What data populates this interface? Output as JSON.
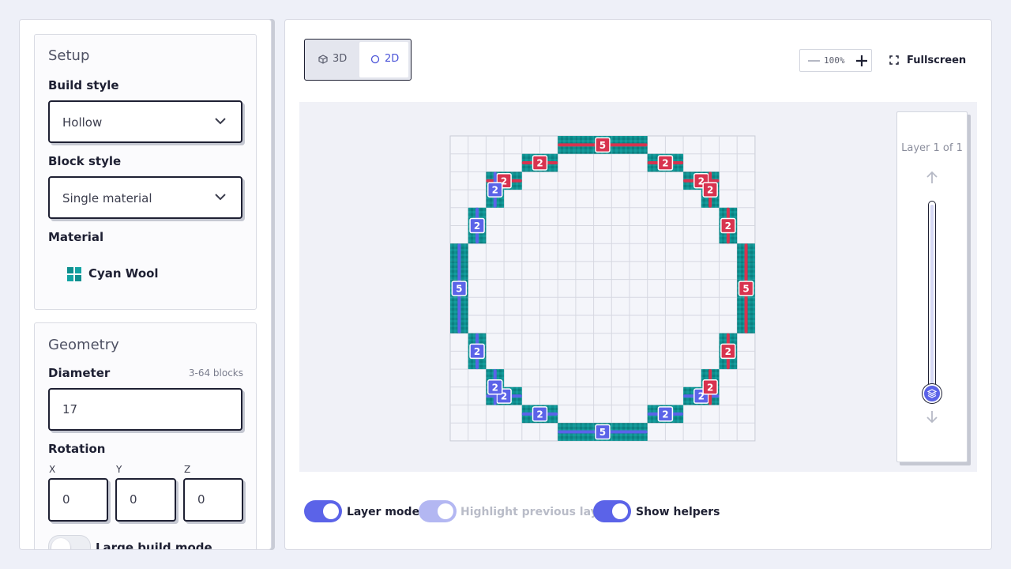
{
  "setup": {
    "title": "Setup",
    "build_style_label": "Build style",
    "build_style_value": "Hollow",
    "block_style_label": "Block style",
    "block_style_value": "Single material",
    "material_label": "Material",
    "material_value": "Cyan Wool"
  },
  "geometry": {
    "title": "Geometry",
    "diameter_label": "Diameter",
    "diameter_hint": "3-64 blocks",
    "diameter_value": "17",
    "rotation_label": "Rotation",
    "rotation": {
      "x_label": "X",
      "x_value": "0",
      "y_label": "Y",
      "y_value": "0",
      "z_label": "Z",
      "z_value": "0"
    },
    "large_build_label": "Large build mode",
    "large_build_on": false
  },
  "toolbar": {
    "view_3d": "3D",
    "view_2d": "2D",
    "active_view": "2D",
    "zoom_value": "100%",
    "fullscreen_label": "Fullscreen"
  },
  "layers": {
    "label": "Layer 1 of 1",
    "current": 1,
    "total": 1
  },
  "toggles": {
    "layer_mode_label": "Layer mode",
    "layer_mode_on": true,
    "highlight_label": "Highlight previous layer",
    "highlight_on": true,
    "highlight_disabled": true,
    "show_helpers_label": "Show helpers",
    "show_helpers_on": true
  },
  "colors": {
    "accent": "#5b63e8",
    "block": "#0f8f8f",
    "helper_red": "#d8334f",
    "helper_blue": "#5b63e8"
  },
  "grid": {
    "size": 17,
    "filled_runs": [
      {
        "row": 0,
        "cols": [
          6,
          10
        ]
      },
      {
        "row": 1,
        "cols": [
          4,
          5
        ]
      },
      {
        "row": 1,
        "cols": [
          11,
          12
        ]
      },
      {
        "row": 2,
        "cols": [
          2,
          3
        ]
      },
      {
        "row": 2,
        "cols": [
          13,
          14
        ]
      },
      {
        "row": 3,
        "cols": [
          2,
          2
        ]
      },
      {
        "row": 3,
        "cols": [
          14,
          14
        ]
      },
      {
        "row": 4,
        "cols": [
          1,
          1
        ]
      },
      {
        "row": 4,
        "cols": [
          15,
          15
        ]
      },
      {
        "row": 5,
        "cols": [
          1,
          1
        ]
      },
      {
        "row": 5,
        "cols": [
          15,
          15
        ]
      },
      {
        "row": 6,
        "cols": [
          0,
          0
        ]
      },
      {
        "row": 6,
        "cols": [
          16,
          16
        ]
      },
      {
        "row": 7,
        "cols": [
          0,
          0
        ]
      },
      {
        "row": 7,
        "cols": [
          16,
          16
        ]
      },
      {
        "row": 8,
        "cols": [
          0,
          0
        ]
      },
      {
        "row": 8,
        "cols": [
          16,
          16
        ]
      },
      {
        "row": 9,
        "cols": [
          0,
          0
        ]
      },
      {
        "row": 9,
        "cols": [
          16,
          16
        ]
      },
      {
        "row": 10,
        "cols": [
          0,
          0
        ]
      },
      {
        "row": 10,
        "cols": [
          16,
          16
        ]
      },
      {
        "row": 11,
        "cols": [
          1,
          1
        ]
      },
      {
        "row": 11,
        "cols": [
          15,
          15
        ]
      },
      {
        "row": 12,
        "cols": [
          1,
          1
        ]
      },
      {
        "row": 12,
        "cols": [
          15,
          15
        ]
      },
      {
        "row": 13,
        "cols": [
          2,
          2
        ]
      },
      {
        "row": 13,
        "cols": [
          14,
          14
        ]
      },
      {
        "row": 14,
        "cols": [
          2,
          3
        ]
      },
      {
        "row": 14,
        "cols": [
          13,
          14
        ]
      },
      {
        "row": 15,
        "cols": [
          4,
          5
        ]
      },
      {
        "row": 15,
        "cols": [
          11,
          12
        ]
      },
      {
        "row": 16,
        "cols": [
          6,
          10
        ]
      }
    ],
    "helpers": [
      {
        "dir": "h",
        "color": "red",
        "row": 0,
        "start": 6,
        "end": 10,
        "label": "5"
      },
      {
        "dir": "h",
        "color": "red",
        "row": 1,
        "start": 4,
        "end": 5,
        "label": "2"
      },
      {
        "dir": "h",
        "color": "red",
        "row": 1,
        "start": 11,
        "end": 12,
        "label": "2"
      },
      {
        "dir": "h",
        "color": "red",
        "row": 2,
        "start": 2,
        "end": 3,
        "label": "2"
      },
      {
        "dir": "h",
        "color": "red",
        "row": 2,
        "start": 13,
        "end": 14,
        "label": "2"
      },
      {
        "dir": "v",
        "color": "blue",
        "col": 2,
        "start": 2,
        "end": 3,
        "label": "2"
      },
      {
        "dir": "v",
        "color": "red",
        "col": 14,
        "start": 2,
        "end": 3,
        "label": "2"
      },
      {
        "dir": "v",
        "color": "blue",
        "col": 1,
        "start": 4,
        "end": 5,
        "label": "2"
      },
      {
        "dir": "v",
        "color": "red",
        "col": 15,
        "start": 4,
        "end": 5,
        "label": "2"
      },
      {
        "dir": "v",
        "color": "blue",
        "col": 0,
        "start": 6,
        "end": 10,
        "label": "5"
      },
      {
        "dir": "v",
        "color": "red",
        "col": 16,
        "start": 6,
        "end": 10,
        "label": "5"
      },
      {
        "dir": "v",
        "color": "blue",
        "col": 1,
        "start": 11,
        "end": 12,
        "label": "2"
      },
      {
        "dir": "v",
        "color": "red",
        "col": 15,
        "start": 11,
        "end": 12,
        "label": "2"
      },
      {
        "dir": "h",
        "color": "blue",
        "row": 14,
        "start": 2,
        "end": 3,
        "label": "2"
      },
      {
        "dir": "h",
        "color": "blue",
        "row": 14,
        "start": 13,
        "end": 14,
        "label": "2"
      },
      {
        "dir": "v",
        "color": "blue",
        "col": 2,
        "start": 13,
        "end": 14,
        "label": "2"
      },
      {
        "dir": "v",
        "color": "red",
        "col": 14,
        "start": 13,
        "end": 14,
        "label": "2"
      },
      {
        "dir": "h",
        "color": "blue",
        "row": 15,
        "start": 4,
        "end": 5,
        "label": "2"
      },
      {
        "dir": "h",
        "color": "blue",
        "row": 15,
        "start": 11,
        "end": 12,
        "label": "2"
      },
      {
        "dir": "h",
        "color": "blue",
        "row": 16,
        "start": 6,
        "end": 10,
        "label": "5"
      }
    ]
  }
}
